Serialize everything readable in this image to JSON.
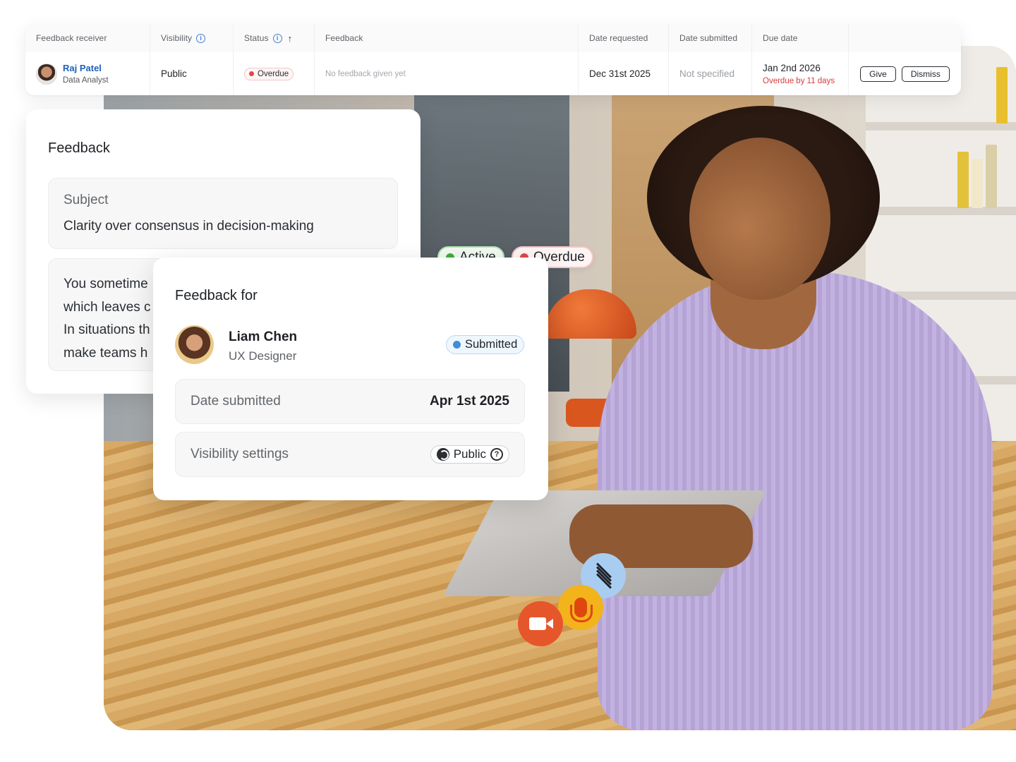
{
  "colors": {
    "link_blue": "#1e5fb8",
    "overdue_red": "#d93b3b",
    "active_green": "#3fae3c",
    "submitted_blue": "#3f8ed8",
    "video_orange": "#e6562b",
    "mic_yellow": "#f2b31b",
    "transcript_blue": "#a9cdf0"
  },
  "table": {
    "headers": {
      "receiver": "Feedback receiver",
      "visibility": "Visibility",
      "status": "Status",
      "feedback": "Feedback",
      "date_requested": "Date requested",
      "date_submitted": "Date submitted",
      "due_date": "Due date"
    },
    "row": {
      "name": "Raj Patel",
      "role": "Data Analyst",
      "visibility": "Public",
      "status": "Overdue",
      "feedback": "No feedback given yet",
      "date_requested": "Dec 31st 2025",
      "date_submitted": "Not specified",
      "due_date": "Jan 2nd 2026",
      "overdue_note": "Overdue by 11 days",
      "give_label": "Give",
      "dismiss_label": "Dismiss"
    }
  },
  "feedback_card": {
    "title": "Feedback",
    "subject_label": "Subject",
    "subject_value": "Clarity over consensus in decision-making",
    "body_lines": [
      "You sometime",
      "which leaves c",
      "In situations th",
      "make teams h"
    ]
  },
  "floating_pills": {
    "active": "Active",
    "overdue": "Overdue"
  },
  "feedback_for_card": {
    "title": "Feedback for",
    "name": "Liam Chen",
    "role": "UX Designer",
    "status": "Submitted",
    "date_submitted_label": "Date submitted",
    "date_submitted_value": "Apr 1st 2025",
    "visibility_label": "Visibility settings",
    "visibility_value": "Public"
  },
  "media_buttons": {
    "transcript_icon": "transcript-icon",
    "mic_icon": "microphone-icon",
    "video_icon": "video-camera-icon"
  }
}
